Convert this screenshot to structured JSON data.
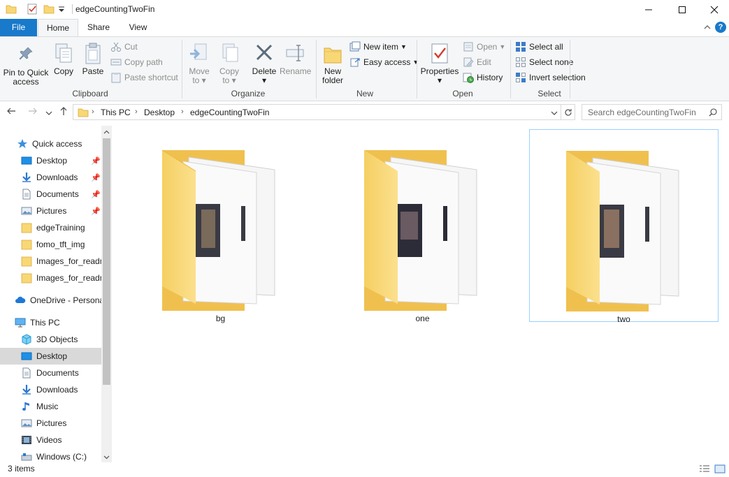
{
  "window": {
    "title": "edgeCountingTwoFin",
    "minimize": "minimize",
    "maximize": "maximize",
    "close": "close"
  },
  "tabs": {
    "file": "File",
    "home": "Home",
    "share": "Share",
    "view": "View"
  },
  "ribbon": {
    "clipboard": {
      "label": "Clipboard",
      "pin": "Pin to Quick access",
      "pin_l1": "Pin to Quick",
      "pin_l2": "access",
      "copy": "Copy",
      "paste": "Paste",
      "cut": "Cut",
      "copy_path": "Copy path",
      "paste_shortcut": "Paste shortcut"
    },
    "organize": {
      "label": "Organize",
      "move_l1": "Move",
      "move_l2": "to",
      "copy_l1": "Copy",
      "copy_l2": "to",
      "delete": "Delete",
      "rename": "Rename"
    },
    "new": {
      "label": "New",
      "new_folder_l1": "New",
      "new_folder_l2": "folder",
      "new_item": "New item",
      "easy_access": "Easy access"
    },
    "open": {
      "label": "Open",
      "properties": "Properties",
      "open": "Open",
      "edit": "Edit",
      "history": "History"
    },
    "select": {
      "label": "Select",
      "select_all": "Select all",
      "select_none": "Select none",
      "invert": "Invert selection"
    }
  },
  "address": {
    "crumbs": [
      "This PC",
      "Desktop",
      "edgeCountingTwoFin"
    ],
    "search_placeholder": "Search edgeCountingTwoFin"
  },
  "nav": {
    "quick_access": "Quick access",
    "qa_items": [
      {
        "label": "Desktop",
        "pinned": true
      },
      {
        "label": "Downloads",
        "pinned": true
      },
      {
        "label": "Documents",
        "pinned": true
      },
      {
        "label": "Pictures",
        "pinned": true
      },
      {
        "label": "edgeTraining",
        "pinned": false
      },
      {
        "label": "fomo_tft_img",
        "pinned": false
      },
      {
        "label": "Images_for_readm",
        "pinned": false
      },
      {
        "label": "Images_for_readm",
        "pinned": false
      }
    ],
    "onedrive": "OneDrive - Persona",
    "this_pc": "This PC",
    "pc_items": [
      "3D Objects",
      "Desktop",
      "Documents",
      "Downloads",
      "Music",
      "Pictures",
      "Videos",
      "Windows (C:)"
    ],
    "selected": "Desktop"
  },
  "content": {
    "folders": [
      {
        "name": "bg",
        "selected": false
      },
      {
        "name": "one",
        "selected": false
      },
      {
        "name": "two",
        "selected": true
      }
    ]
  },
  "status": {
    "count": "3 items"
  },
  "colors": {
    "accent": "#1979ca",
    "folder_yellow": "#f8d775",
    "selection": "#cce8ff"
  }
}
